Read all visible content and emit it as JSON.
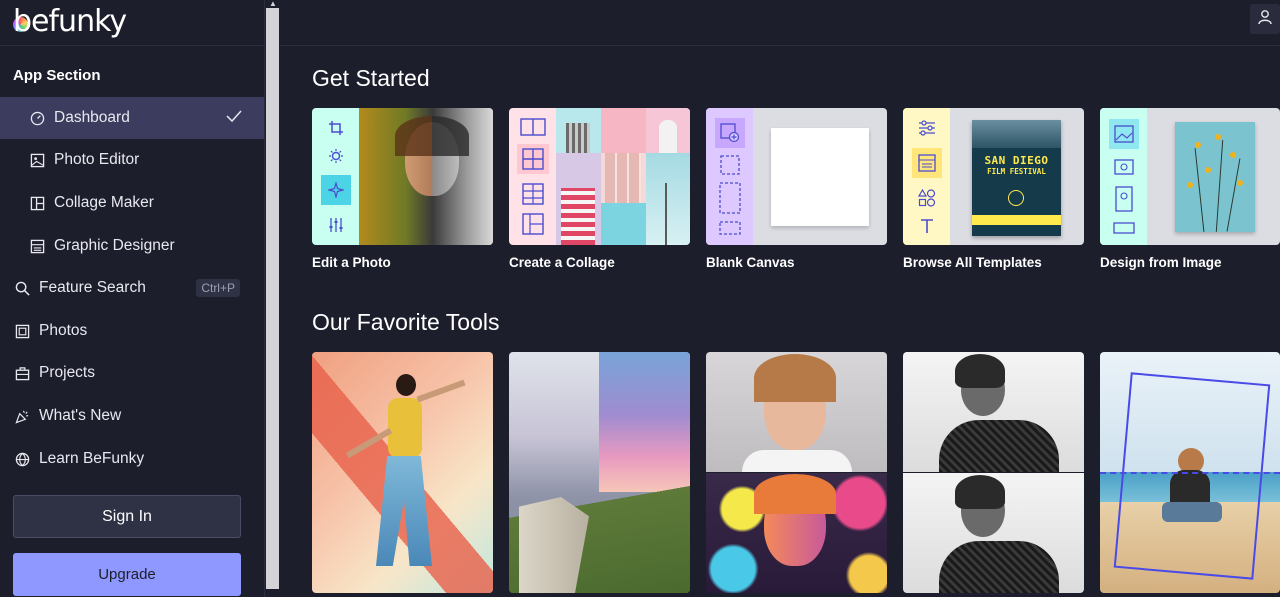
{
  "app": {
    "logo_text": "befunky"
  },
  "sidebar": {
    "section_title": "App Section",
    "items": [
      {
        "label": "Dashboard"
      },
      {
        "label": "Photo Editor"
      },
      {
        "label": "Collage Maker"
      },
      {
        "label": "Graphic Designer"
      },
      {
        "label": "Feature Search",
        "shortcut": "Ctrl+P"
      },
      {
        "label": "Photos"
      },
      {
        "label": "Projects"
      },
      {
        "label": "What's New"
      },
      {
        "label": "Learn BeFunky"
      }
    ],
    "sign_in_label": "Sign In",
    "upgrade_label": "Upgrade"
  },
  "main": {
    "get_started_title": "Get Started",
    "get_started_cards": [
      {
        "label": "Edit a Photo"
      },
      {
        "label": "Create a Collage"
      },
      {
        "label": "Blank Canvas"
      },
      {
        "label": "Browse All Templates"
      },
      {
        "label": "Design from Image"
      }
    ],
    "poster": {
      "line1": "SAN DIEGO",
      "line2": "FILM FESTIVAL"
    },
    "favorite_tools_title": "Our Favorite Tools"
  },
  "colors": {
    "accent": "#8f98ff",
    "active_bg": "#3b3c5e",
    "bg": "#1d1e2c"
  }
}
